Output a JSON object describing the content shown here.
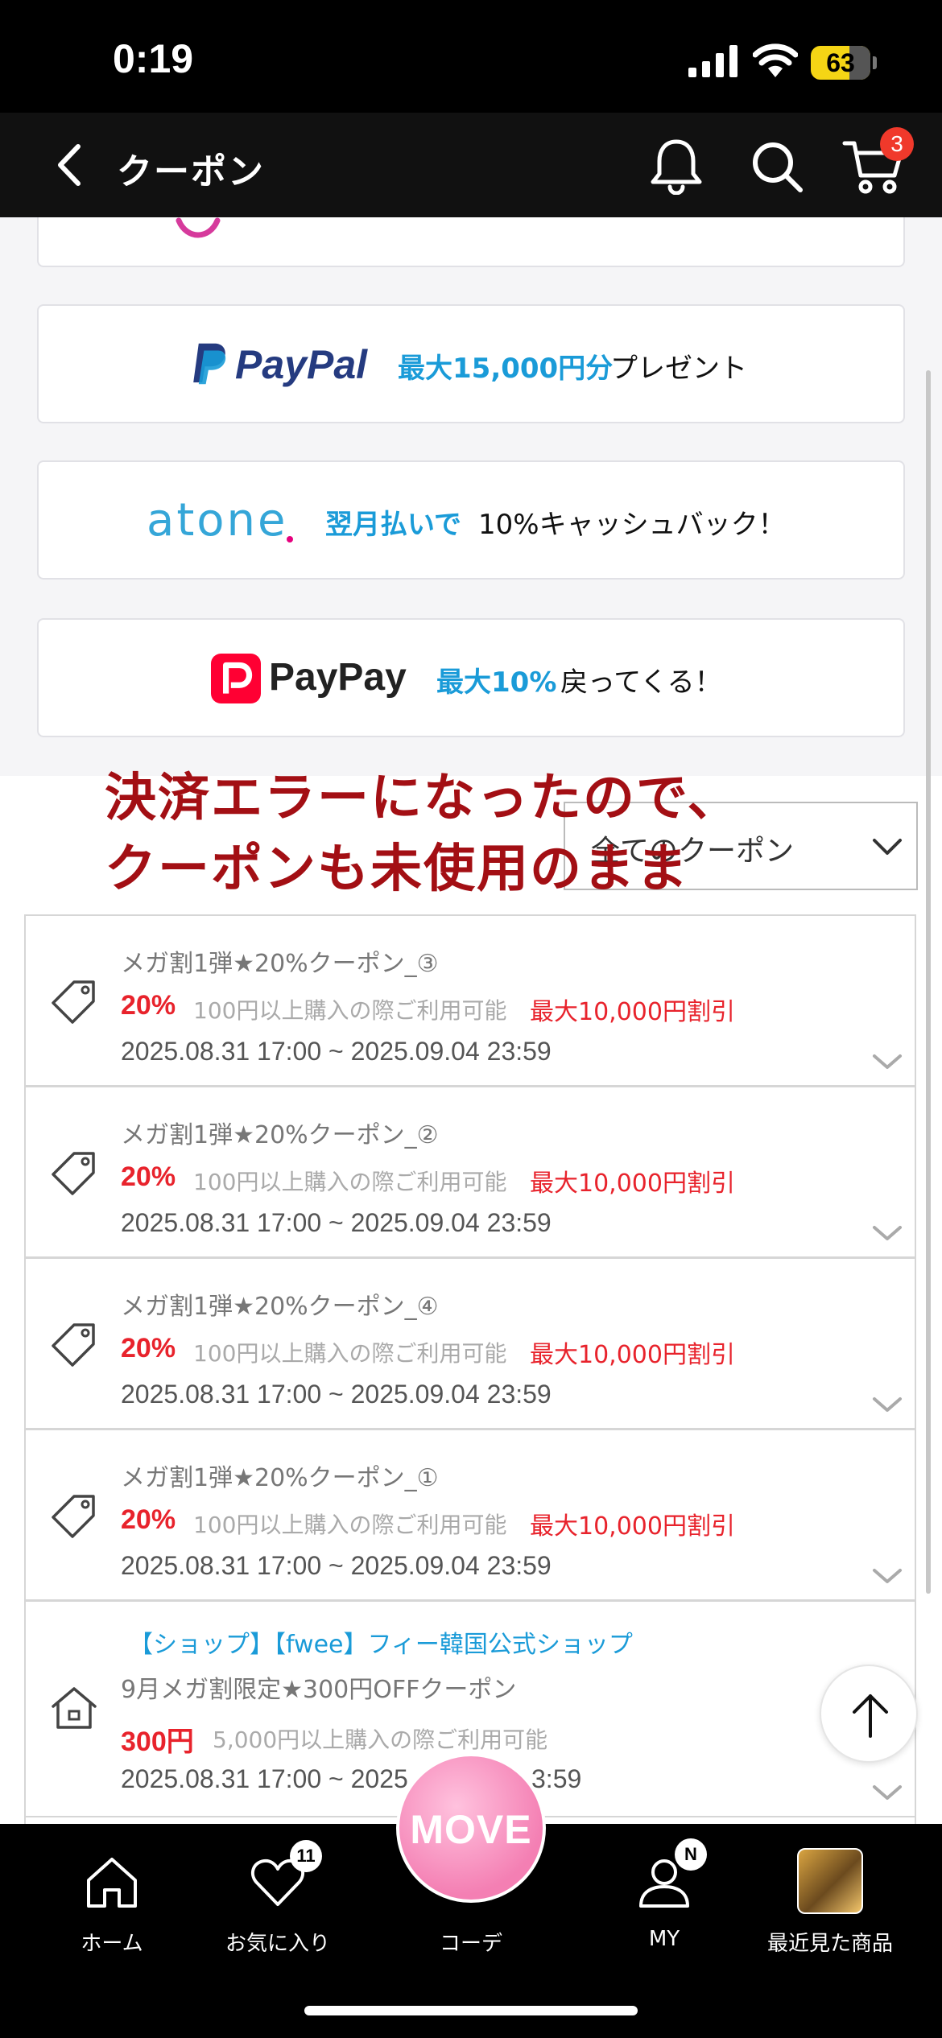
{
  "status_bar": {
    "time": "0:19",
    "battery": "63"
  },
  "header": {
    "title": "クーポン",
    "cart_count": "3"
  },
  "payment_banners": [
    {
      "brand": "PayPal",
      "highlight": "最大15,000円分",
      "text": "プレゼント"
    },
    {
      "brand": "atone",
      "highlight": "翌月払いで",
      "text": "10%キャッシュバック！"
    },
    {
      "brand": "PayPay",
      "highlight": "最大10%",
      "text": "戻ってくる！"
    }
  ],
  "filter": {
    "selected": "全てのクーポン"
  },
  "overlay_note": {
    "line1": "決済エラーになったので、",
    "line2": "クーポンも未使用のまま"
  },
  "coupons": [
    {
      "name": "メガ割1弾★20%クーポン_③",
      "discount": "20%",
      "condition": "100円以上購入の際ご利用可能",
      "max": "最大10,000円割引",
      "period": "2025.08.31 17:00 ~ 2025.09.04 23:59"
    },
    {
      "name": "メガ割1弾★20%クーポン_②",
      "discount": "20%",
      "condition": "100円以上購入の際ご利用可能",
      "max": "最大10,000円割引",
      "period": "2025.08.31 17:00 ~ 2025.09.04 23:59"
    },
    {
      "name": "メガ割1弾★20%クーポン_④",
      "discount": "20%",
      "condition": "100円以上購入の際ご利用可能",
      "max": "最大10,000円割引",
      "period": "2025.08.31 17:00 ~ 2025.09.04 23:59"
    },
    {
      "name": "メガ割1弾★20%クーポン_①",
      "discount": "20%",
      "condition": "100円以上購入の際ご利用可能",
      "max": "最大10,000円割引",
      "period": "2025.08.31 17:00 ~ 2025.09.04 23:59"
    }
  ],
  "shop_coupon": {
    "shop": "【ショップ】【fwee】フィー韓国公式ショップ",
    "name": "9月メガ割限定★300円OFFクーポン",
    "discount": "300円",
    "condition": "5,000円以上購入の際ご利用可能",
    "period_start": "2025.08.31 17:00 ~ 2025",
    "period_end": "3:59"
  },
  "bottom_nav": {
    "home": "ホーム",
    "favorites": "お気に入り",
    "favorites_count": "11",
    "coordinate": "コーデ",
    "move": "MOVE",
    "my": "MY",
    "my_badge": "N",
    "recent": "最近見た商品"
  },
  "colors": {
    "accent_blue": "#1a9bd8",
    "discount_red": "#e8232c",
    "note_red": "#a30f14",
    "move_pink": "#f47fb3"
  }
}
